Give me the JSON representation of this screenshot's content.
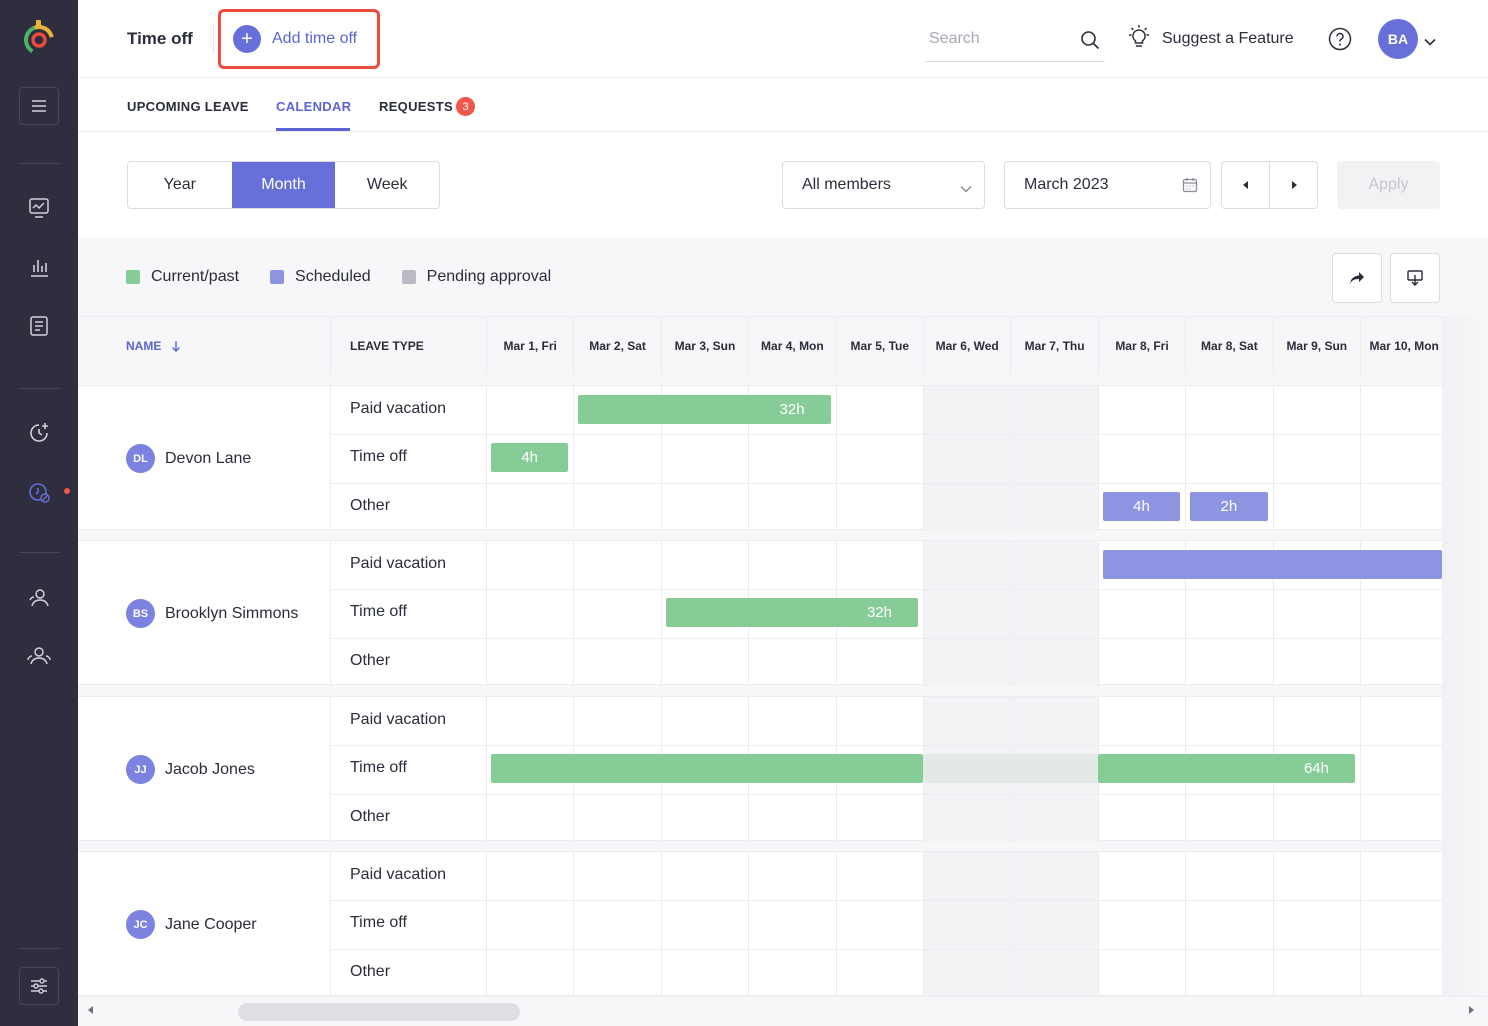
{
  "header": {
    "title": "Time off",
    "add_label": "Add time off",
    "search_placeholder": "Search",
    "suggest_label": "Suggest a Feature",
    "avatar_initials": "BA"
  },
  "tabs": [
    {
      "label": "UPCOMING LEAVE"
    },
    {
      "label": "CALENDAR",
      "active": true
    },
    {
      "label": "REQUESTS",
      "badge": "3"
    }
  ],
  "controls": {
    "view_modes": [
      "Year",
      "Month",
      "Week"
    ],
    "active_view": "Month",
    "members": "All members",
    "date": "March 2023",
    "apply_label": "Apply"
  },
  "legend": [
    {
      "label": "Current/past",
      "color": "#86cc97"
    },
    {
      "label": "Scheduled",
      "color": "#8d95e3"
    },
    {
      "label": "Pending approval",
      "color": "#b9bac2"
    }
  ],
  "grid": {
    "name_header": "NAME",
    "type_header": "LEAVE TYPE",
    "days": [
      "Mar 1, Fri",
      "Mar 2, Sat",
      "Mar 3, Sun",
      "Mar 4, Mon",
      "Mar 5, Tue",
      "Mar 6, Wed",
      "Mar 7, Thu",
      "Mar 8, Fri",
      "Mar 8, Sat",
      "Mar 9, Sun",
      "Mar 10, Mon"
    ],
    "leave_types": [
      "Paid vacation",
      "Time off",
      "Other"
    ]
  },
  "people": [
    {
      "initials": "DL",
      "name": "Devon Lane",
      "bars": [
        {
          "row": 0,
          "start": 1,
          "span": 3,
          "label": "32h",
          "color": "green"
        },
        {
          "row": 1,
          "start": 0,
          "span": 1,
          "label": "4h",
          "color": "green",
          "center": true
        },
        {
          "row": 2,
          "start": 7,
          "span": 1,
          "label": "4h",
          "color": "blue",
          "center": true
        },
        {
          "row": 2,
          "start": 8,
          "span": 1,
          "label": "2h",
          "color": "blue",
          "center": true
        }
      ]
    },
    {
      "initials": "BS",
      "name": "Brooklyn Simmons",
      "bars": [
        {
          "row": 0,
          "start": 7,
          "span": 4,
          "label": "",
          "color": "blue"
        },
        {
          "row": 1,
          "start": 2,
          "span": 3,
          "label": "32h",
          "color": "green"
        }
      ]
    },
    {
      "initials": "JJ",
      "name": "Jacob Jones",
      "bars": [
        {
          "row": 1,
          "start": 0,
          "span": 5,
          "label": "",
          "color": "green"
        },
        {
          "row": 1,
          "start": 5,
          "span": 2,
          "label": "",
          "color": "gap"
        },
        {
          "row": 1,
          "start": 7,
          "span": 3,
          "label": "64h",
          "color": "green"
        }
      ]
    },
    {
      "initials": "JC",
      "name": "Jane Cooper",
      "bars": []
    }
  ],
  "icons": {
    "logo": "app-logo-icon",
    "menu": "hamburger-icon",
    "search": "search-icon",
    "suggest": "lightbulb-icon",
    "help": "help-icon",
    "share": "share-icon",
    "download": "download-icon",
    "calendar": "calendar-icon"
  }
}
